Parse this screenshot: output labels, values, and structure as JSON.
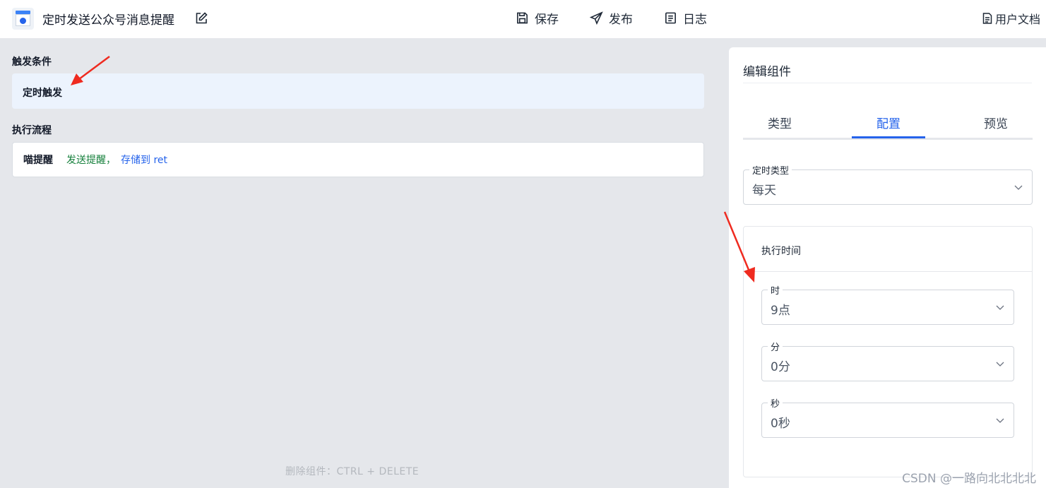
{
  "header": {
    "title": "定时发送公众号消息提醒",
    "save_label": "保存",
    "publish_label": "发布",
    "log_label": "日志",
    "docs_label": "用户文档"
  },
  "canvas": {
    "trigger_section_label": "触发条件",
    "trigger_item": "定时触发",
    "flow_section_label": "执行流程",
    "flow_item": {
      "name": "喵提醒",
      "description": "发送提醒，",
      "store": "存储到 ret"
    },
    "footer_hint": "删除组件：CTRL + DELETE"
  },
  "panel": {
    "title": "编辑组件",
    "tabs": [
      "类型",
      "配置",
      "预览"
    ],
    "active_tab": "配置",
    "timer_type": {
      "label": "定时类型",
      "value": "每天"
    },
    "exec_time": {
      "title": "执行时间",
      "hour": {
        "label": "时",
        "value": "9点"
      },
      "minute": {
        "label": "分",
        "value": "0分"
      },
      "second": {
        "label": "秒",
        "value": "0秒"
      }
    }
  },
  "watermark": "CSDN @一路向北北北北",
  "colors": {
    "accent": "#2563eb",
    "trigger_bg": "#ecf3fd",
    "flow_desc": "#16803c",
    "annotation_arrow": "#ef2b20"
  }
}
